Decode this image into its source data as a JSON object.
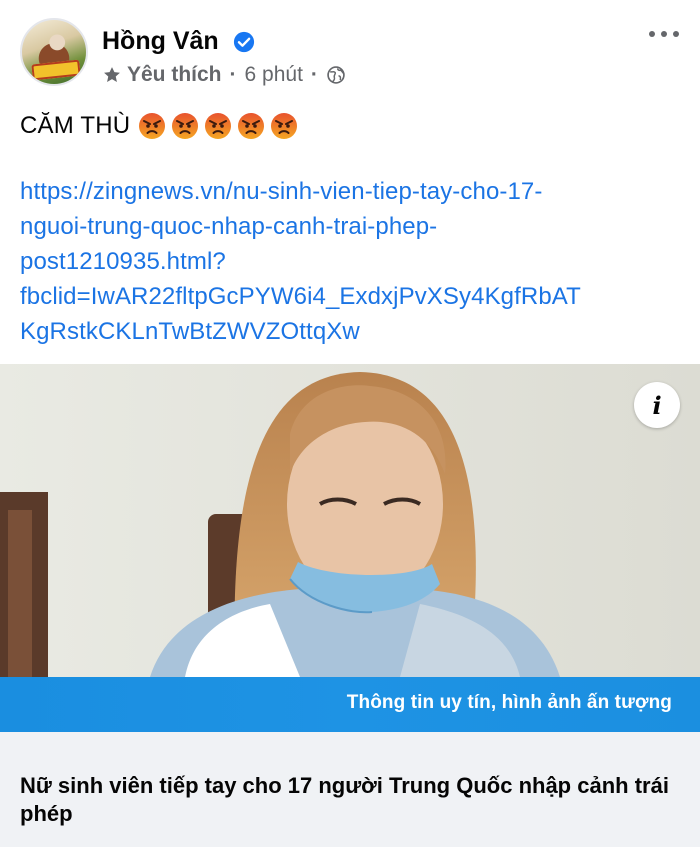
{
  "post": {
    "author": "Hồng Vân",
    "follow_label": "Yêu thích",
    "time": "6 phút",
    "separator": "·",
    "status_text": "CĂM THÙ",
    "status_emojis": [
      "angry-face",
      "angry-face",
      "angry-face",
      "angry-face",
      "angry-face"
    ],
    "link_lines": [
      "https://zingnews.vn/nu-sinh-vien-tiep-tay-cho-17-",
      "nguoi-trung-quoc-nhap-canh-trai-phep-",
      "post1210935.html?",
      "fbclid=IwAR22fltpGcPYW6i4_ExdxjPvXSy4KgfRbAT",
      "KgRstkCKLnTwBtZWVZOttqXw"
    ]
  },
  "card": {
    "info_label": "i",
    "banner_text": "Thông tin uy tín, hình ảnh ấn tượng",
    "title": "Nữ sinh viên tiếp tay cho 17 người Trung Quốc nhập cảnh trái phép"
  },
  "colors": {
    "link": "#1b74e4",
    "verified": "#1877f2",
    "banner": "#1a8ee0",
    "footer_bg": "#f0f2f5",
    "meta_text": "#65676b"
  },
  "icons": {
    "verified": "verified-badge-icon",
    "star": "star-icon",
    "globe": "globe-icon",
    "more": "more-options-icon",
    "info": "info-icon",
    "angry": "angry-face-icon"
  }
}
